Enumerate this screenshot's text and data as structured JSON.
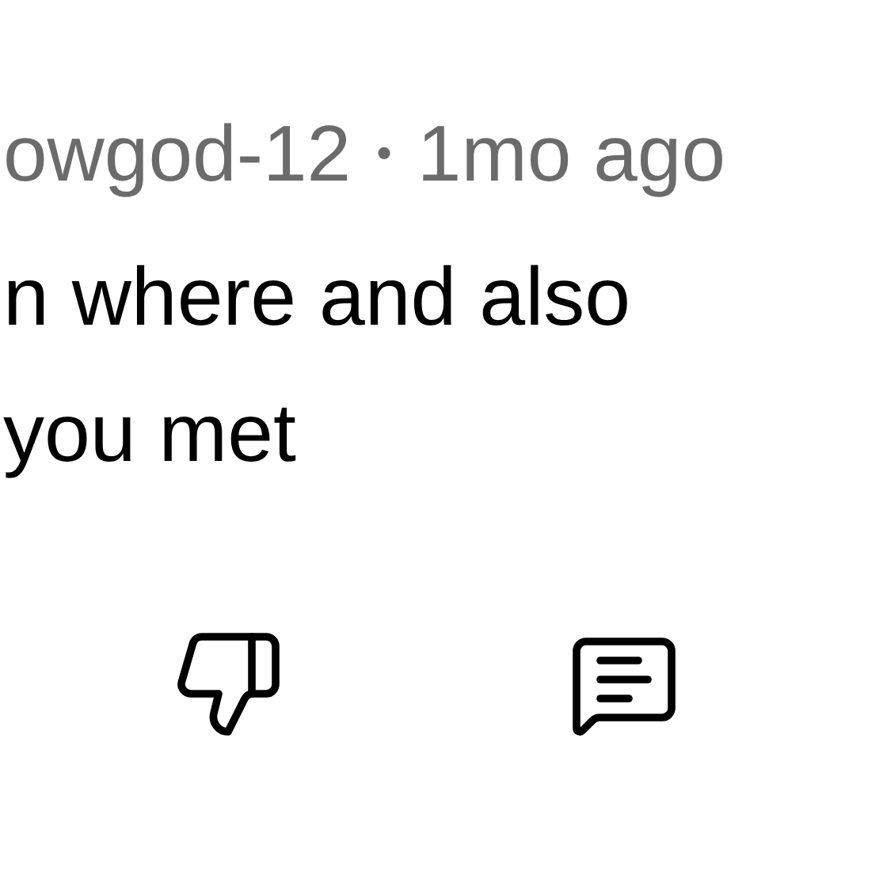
{
  "comment": {
    "author": "owgod-12",
    "separator": "•",
    "time": "1mo ago",
    "body_lines": [
      "n where and also",
      "you met"
    ]
  },
  "actions": [
    {
      "kind": "downvote"
    },
    {
      "kind": "reply"
    }
  ]
}
